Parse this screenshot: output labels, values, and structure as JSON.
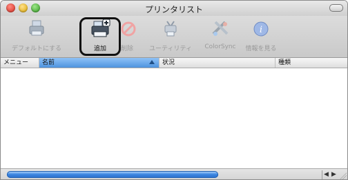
{
  "window": {
    "title": "プリンタリスト"
  },
  "toolbar": {
    "items": [
      {
        "label": "デフォルトにする",
        "icon": "printer-default-icon",
        "enabled": false
      },
      {
        "label": "追加",
        "icon": "printer-add-icon",
        "enabled": true
      },
      {
        "label": "削除",
        "icon": "delete-icon",
        "enabled": false
      },
      {
        "label": "ユーティリティ",
        "icon": "utility-icon",
        "enabled": false
      },
      {
        "label": "ColorSync",
        "icon": "colorsync-icon",
        "enabled": false
      },
      {
        "label": "情報を見る",
        "icon": "info-icon",
        "enabled": false
      }
    ]
  },
  "list": {
    "columns": [
      {
        "label": "メニュー"
      },
      {
        "label": "名前"
      },
      {
        "label": "状況"
      },
      {
        "label": "種類"
      }
    ]
  },
  "colors": {
    "accent": "#4e93de",
    "highlight": "#111111"
  }
}
